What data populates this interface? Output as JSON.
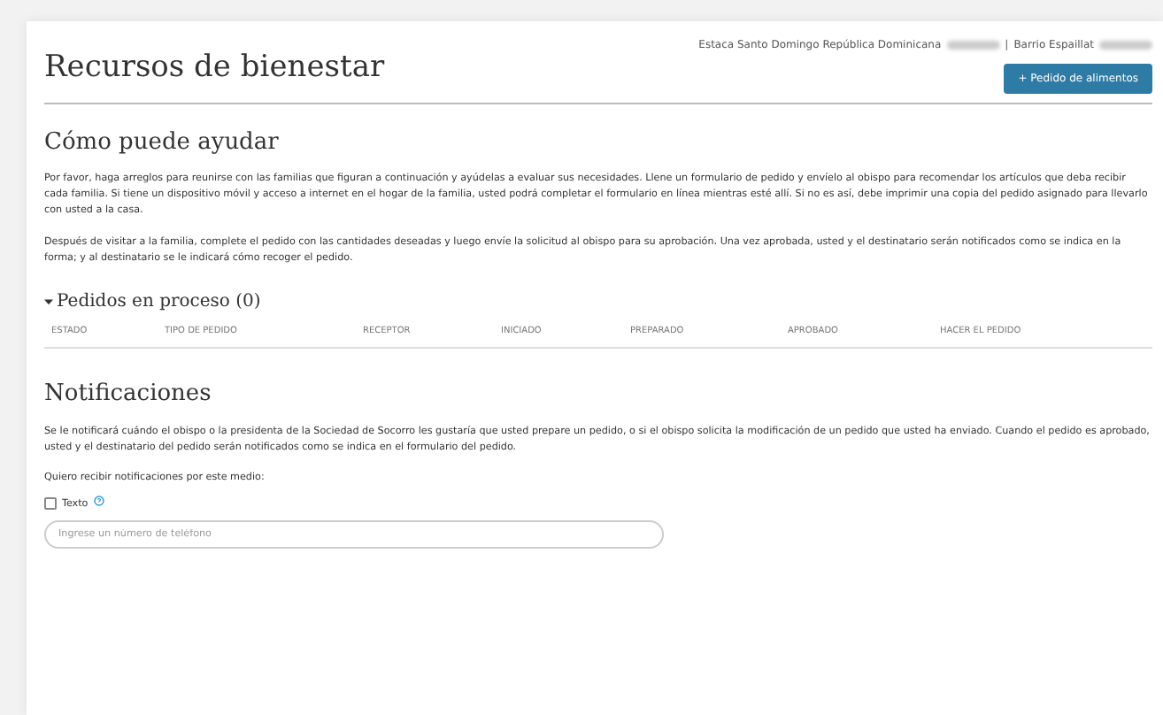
{
  "header": {
    "unit": "Estaca Santo Domingo República Dominicana",
    "separator": "|",
    "ward": "Barrio Espaillat",
    "title": "Recursos de bienestar",
    "action_button": "+ Pedido de alimentos"
  },
  "help": {
    "heading": "Cómo puede ayudar",
    "paragraphs": [
      "Por favor, haga arreglos para reunirse con las familias que figuran a continuación y ayúdelas a evaluar sus necesidades. Llene un formulario de pedido y envíelo al obispo para recomendar los artículos que deba recibir cada familia. Si tiene un dispositivo móvil y acceso a internet en el hogar de la familia, usted podrá completar el formulario en línea mientras esté allí. Si no es así, debe imprimir una copia del pedido asignado para llevarlo con usted a la casa.",
      "Después de visitar a la familia, complete el pedido con las cantidades deseadas y luego envíe la solicitud al obispo para su aprobación. Una vez aprobada, usted y el destinatario serán notificados como se indica en la forma; y al destinatario se le indicará cómo recoger el pedido."
    ]
  },
  "orders": {
    "heading": "Pedidos en proceso (0)",
    "expanded": true,
    "columns": [
      "ESTADO",
      "TIPO DE PEDIDO",
      "RECEPTOR",
      "INICIADO",
      "PREPARADO",
      "APROBADO",
      "HACER EL PEDIDO"
    ]
  },
  "notifications": {
    "heading": "Notificaciones",
    "paragraph": "Se le notificará cuándo el obispo o la presidenta de la Sociedad de Socorro les gustaría que usted prepare un pedido, o si el obispo solicita la modificación de un pedido que usted ha enviado. Cuando el pedido es aprobado, usted y el destinatario del pedido serán notificados como se indica en el formulario del pedido.",
    "prompt": "Quiero recibir notificaciones por este medio:",
    "text_option": {
      "label": "Texto",
      "checked": false
    },
    "phone_placeholder": "Ingrese un número de teléfono"
  }
}
